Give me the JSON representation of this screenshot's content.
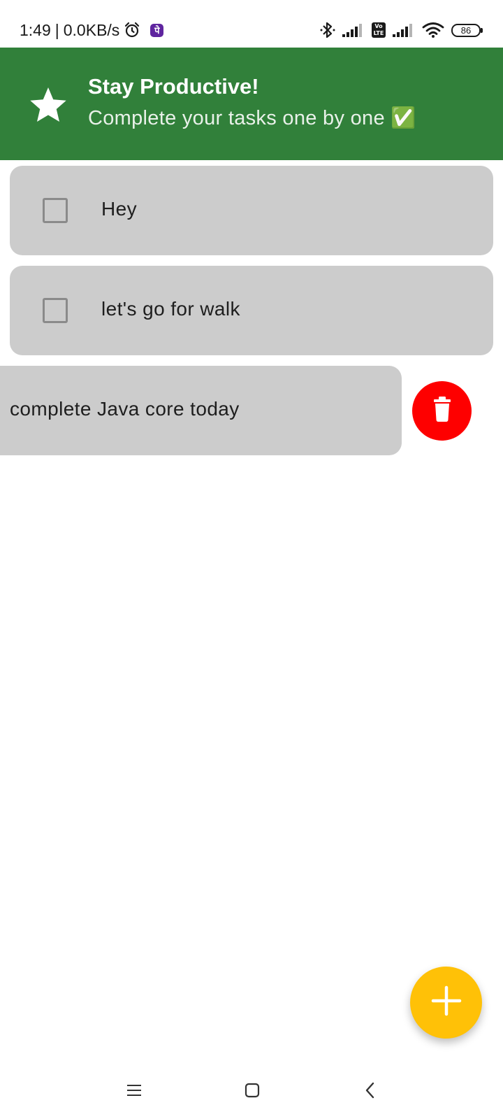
{
  "status_bar": {
    "time": "1:49",
    "separator": "|",
    "net_speed": "0.0KB/s",
    "battery_level": "86",
    "icons": [
      "alarm-icon",
      "phonepe-icon",
      "bluetooth-icon",
      "signal-icon",
      "volte-icon",
      "signal-icon",
      "wifi-icon",
      "battery-icon"
    ]
  },
  "header": {
    "title": "Stay Productive!",
    "subtitle": "Complete your tasks one by one ✅",
    "icon": "star-icon",
    "background_color": "#31803a"
  },
  "tasks": [
    {
      "text": "Hey",
      "checked": false
    },
    {
      "text": "let's go for walk",
      "checked": false
    },
    {
      "text": "complete Java core today",
      "checked": false,
      "swiped": true
    }
  ],
  "delete_action": {
    "icon": "trash-icon",
    "color": "#fe0000"
  },
  "fab": {
    "icon": "plus-icon",
    "color": "#ffc107"
  },
  "nav_bar": {
    "buttons": [
      "menu-icon",
      "home-icon",
      "back-icon"
    ]
  },
  "colors": {
    "card": "#cccccc",
    "checkbox_border": "#8a8a8a",
    "text": "#1e1e1e"
  }
}
